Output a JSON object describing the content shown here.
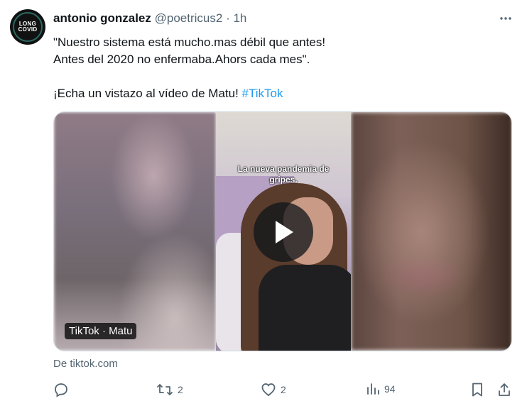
{
  "tweet": {
    "author_name": "antonio gonzalez",
    "handle": "@poetricus2",
    "separator": "·",
    "time": "1h",
    "avatar_text": [
      "LONG",
      "COVID"
    ],
    "lines": [
      "\"Nuestro sistema está mucho.mas débil que antes!",
      "Antes del 2020 no enfermaba.Ahors cada mes\"."
    ],
    "share_text": "¡Echa un vistazo al vídeo de Matu! ",
    "hashtag": "#TikTok",
    "icons": {
      "more": "more-icon",
      "play": "play-icon",
      "reply": "reply-icon",
      "retweet": "retweet-icon",
      "like": "like-icon",
      "views": "views-icon",
      "bookmark": "bookmark-icon",
      "share": "share-icon"
    }
  },
  "media": {
    "video_caption": "La nueva pandemia de gripes.",
    "badge": "TikTok · Matu",
    "source": "De tiktok.com"
  },
  "actions": {
    "retweet_count": "2",
    "like_count": "2",
    "views_count": "94"
  },
  "colors": {
    "accent": "#1d9bf0",
    "muted": "#536471",
    "text": "#0f1419"
  }
}
